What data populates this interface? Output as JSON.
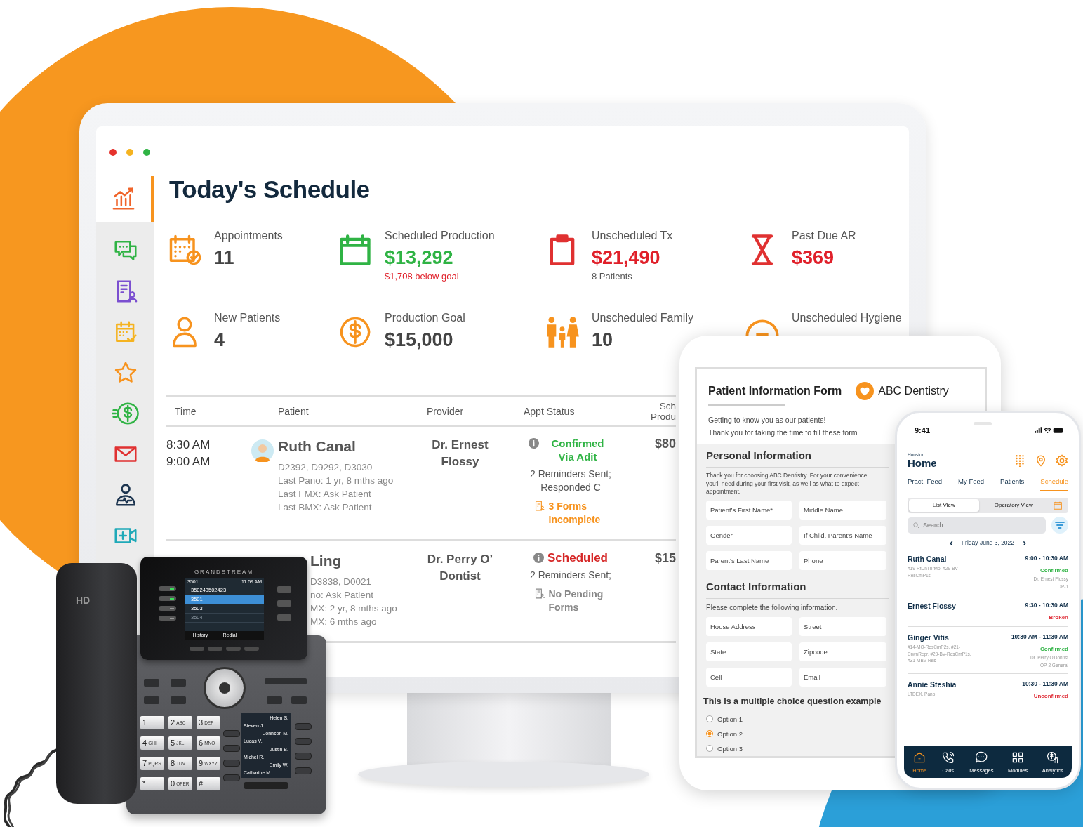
{
  "monitor": {
    "sidebar": [
      {
        "kind": "chart",
        "selected": true
      },
      {
        "kind": "chat",
        "selected": false
      },
      {
        "kind": "form",
        "selected": false
      },
      {
        "kind": "calendar",
        "selected": false
      },
      {
        "kind": "star",
        "selected": false
      },
      {
        "kind": "dollar",
        "selected": false
      },
      {
        "kind": "mail",
        "selected": false
      },
      {
        "kind": "health",
        "selected": false
      },
      {
        "kind": "video",
        "selected": false
      }
    ],
    "title": "Today's Schedule",
    "stats": [
      {
        "kind": "appointments",
        "label": "Appointments",
        "value": "11",
        "color": "#444444"
      },
      {
        "kind": "production",
        "label": "Scheduled Production",
        "value": "$13,292",
        "color": "#2fb344",
        "note": {
          "text": "$1,708 below goal",
          "color": "#e0202a"
        }
      },
      {
        "kind": "unscheduled",
        "label": "Unscheduled Tx",
        "value": "$21,490",
        "color": "#e0202a",
        "note": {
          "text": "8 Patients",
          "color": "#555555"
        }
      },
      {
        "kind": "past_due",
        "label": "Past Due AR",
        "value": "$369",
        "color": "#e0202a"
      },
      {
        "kind": "new_patients",
        "label": "New Patients",
        "value": "4",
        "color": "#444444"
      },
      {
        "kind": "goal",
        "label": "Production Goal",
        "value": "$15,000",
        "color": "#444444"
      },
      {
        "kind": "family",
        "label": "Unscheduled Family",
        "value": "10",
        "color": "#444444"
      },
      {
        "kind": "hygiene",
        "label": "Unscheduled Hygiene"
      }
    ],
    "table": {
      "columns": [
        [
          "Time"
        ],
        [
          "Patient"
        ],
        [
          "Provider"
        ],
        [
          "Appt Status"
        ],
        [
          "Sch",
          "Produ"
        ]
      ],
      "rows": [
        {
          "times": [
            "8:30 AM",
            "9:00 AM"
          ],
          "avatar": true,
          "patient": "Ruth Canal",
          "details": [
            "D2392, D9292, D3030",
            "Last Pano: 1 yr, 8 mths ago",
            "Last FMX: Ask Patient",
            "Last BMX: Ask Patient"
          ],
          "provider": "Dr. Ernest Flossy",
          "status": {
            "text": "Confirmed Via Adit",
            "color": "#2fb344"
          },
          "reminders": "2 Reminders Sent; Responded C",
          "forms": {
            "text": "3 Forms Incomplete",
            "color": "#f7931e"
          },
          "amount": "$80"
        },
        {
          "patient": "Ling",
          "details": [
            "D3838, D0021",
            "no: Ask Patient",
            "MX: 2 yr, 8 mths ago",
            "MX: 6 mths ago"
          ],
          "provider": "Dr. Perry O’ Dontist",
          "status": {
            "text": "Scheduled",
            "color": "#d62828"
          },
          "reminders": "2 Reminders Sent;",
          "forms": {
            "text": "No Pending Forms",
            "color": "#888888"
          },
          "amount": "$15"
        }
      ]
    }
  },
  "tablet": {
    "title": "Patient Information Form",
    "brand": "ABC Dentistry",
    "intro": [
      "Getting to know you as our patients!",
      "Thank you for taking the time to fill these form"
    ],
    "sections": [
      {
        "heading": "Personal Information",
        "text": [
          "Thank you for choosing ABC Dentistry. For your convenience",
          "you’ll need during your first visit, as well as what to expect",
          "appointment."
        ],
        "fields": [
          {
            "placeholder": "Patient’s First Name*"
          },
          {
            "placeholder": "Middle Name"
          },
          {
            "placeholder": "Gender"
          },
          {
            "placeholder": "If Child, Parent’s Name"
          },
          {
            "placeholder": "Parent’s Last Name"
          },
          {
            "placeholder": "Phone"
          }
        ]
      },
      {
        "heading": "Contact Information",
        "text": [
          "Please complete the following information."
        ],
        "fields": [
          {
            "placeholder": "House Address"
          },
          {
            "placeholder": "Street"
          },
          {
            "placeholder": "State"
          },
          {
            "placeholder": "Zipcode"
          },
          {
            "placeholder": "Cell"
          },
          {
            "placeholder": "Email"
          }
        ]
      }
    ],
    "question": "This is a multiple choice question example",
    "options": [
      {
        "label": "Option 1",
        "selected": false
      },
      {
        "label": "Option 2",
        "selected": true
      },
      {
        "label": "Option 3",
        "selected": false
      }
    ]
  },
  "phone": {
    "time": "9:41",
    "location": "Houston",
    "title": "Home",
    "tabs": [
      {
        "label": "Pract. Feed",
        "selected": false
      },
      {
        "label": "My Feed",
        "selected": false
      },
      {
        "label": "Patients",
        "selected": false
      },
      {
        "label": "Schedule",
        "selected": true
      }
    ],
    "views": [
      {
        "label": "List View",
        "selected": true
      },
      {
        "label": "Operatory View",
        "selected": false
      }
    ],
    "search": {
      "placeholder": "Search"
    },
    "prev": "‹",
    "date": "Friday June 3, 2022",
    "next": "›",
    "appointments": [
      {
        "name": "Ruth Canal",
        "time": "9:00 - 10:30 AM",
        "codes": "#19-RtCnThrMo, #29-BV-ResCmP1s",
        "status": {
          "text": "Confirmed",
          "color": "#2fb344"
        },
        "doctor": "Dr. Ernest Flossy",
        "room": "OP-1"
      },
      {
        "name": "Ernest Flossy",
        "time": "9:30 - 10:30 AM",
        "status": {
          "text": "Broken",
          "color": "#e0303a"
        }
      },
      {
        "name": "Ginger Vitis",
        "time": "10:30 AM - 11:30 AM",
        "codes": "#14-MO-ResCmP2s, #21-CrwnRepr, #29-BV-ResCmP1s, #31-MBV-Res",
        "status": {
          "text": "Confirmed",
          "color": "#2fb344"
        },
        "doctor": "Dr. Perry O'Dontist",
        "room": "OP-2 General"
      },
      {
        "name": "Annie Steshia",
        "time": "10:30 - 11:30 AM",
        "codes": "LTDEX, Pano",
        "status": {
          "text": "Unconfirmed",
          "color": "#e0303a"
        }
      }
    ],
    "nav": [
      {
        "kind": "home",
        "label": "Home",
        "selected": true
      },
      {
        "kind": "calls",
        "label": "Calls",
        "selected": false
      },
      {
        "kind": "messages",
        "label": "Messages",
        "selected": false
      },
      {
        "kind": "modules",
        "label": "Modules",
        "selected": false
      },
      {
        "kind": "analytics",
        "label": "Analytics",
        "selected": false
      }
    ]
  },
  "desk_phone": {
    "handset_label": "HD",
    "brand": "GRANDSTREAM",
    "account": "3501",
    "clock": "11:59 AM",
    "lines": [
      {
        "label": "350243502423",
        "active": true,
        "selected": false
      },
      {
        "label": "3501",
        "active": true,
        "selected": true
      },
      {
        "label": "3503",
        "active": false,
        "selected": false
      },
      {
        "label": "3504",
        "active": false,
        "selected": false
      }
    ],
    "softkeys": [
      "History",
      "Redial",
      "···"
    ],
    "keypad": [
      {
        "digit": "1"
      },
      {
        "digit": "2",
        "letters": "ABC"
      },
      {
        "digit": "3",
        "letters": "DEF"
      },
      {
        "digit": "4",
        "letters": "GHI"
      },
      {
        "digit": "5",
        "letters": "JKL"
      },
      {
        "digit": "6",
        "letters": "MNO"
      },
      {
        "digit": "7",
        "letters": "PQRS"
      },
      {
        "digit": "8",
        "letters": "TUV"
      },
      {
        "digit": "9",
        "letters": "WXYZ"
      },
      {
        "digit": "*"
      },
      {
        "digit": "0",
        "letters": "OPER"
      },
      {
        "digit": "#"
      }
    ],
    "contacts": [
      {
        "name": "Helen S.",
        "kind": "call"
      },
      {
        "name": "Steven J.",
        "kind": "person"
      },
      {
        "name": "Johnson M.",
        "kind": "call"
      },
      {
        "name": "Lucas V.",
        "kind": "person"
      },
      {
        "name": "Justin B.",
        "kind": "call"
      },
      {
        "name": "Michel R.",
        "kind": "person"
      },
      {
        "name": "Emily W.",
        "kind": "call"
      },
      {
        "name": "Catharine M.",
        "kind": "person"
      }
    ]
  }
}
